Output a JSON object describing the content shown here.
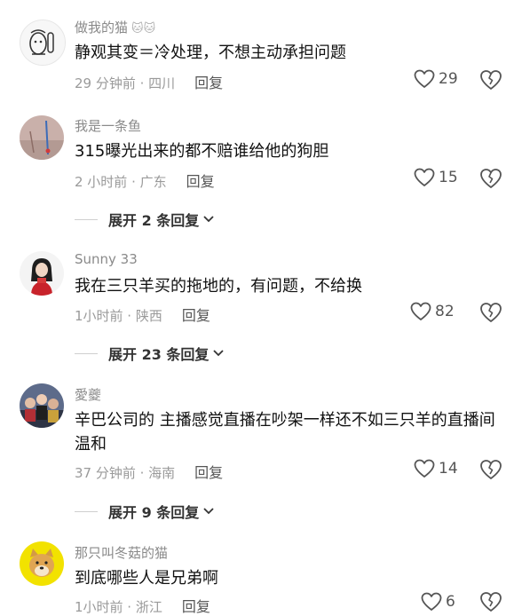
{
  "comments": [
    {
      "username": "做我的猫",
      "username_badge": "🐱🐱",
      "text": "静观其变＝冷处理，不想主动承担问题",
      "time_location": "29 分钟前 · 四川",
      "reply_label": "回复",
      "likes": "29",
      "avatar_icon": "cartoon-sketch-avatar"
    },
    {
      "username": "我是一条鱼",
      "text": "315曝光出来的都不赔谁给他的狗胆",
      "time_location": "2 小时前 · 广东",
      "reply_label": "回复",
      "likes": "15",
      "avatar_icon": "pinkish-photo-avatar"
    },
    {
      "username": "Sunny 33",
      "text": "我在三只羊买的拖地的，有问题，不给换",
      "time_location": "1小时前 · 陕西",
      "reply_label": "回复",
      "likes": "82",
      "avatar_icon": "girl-red-scarf-avatar"
    },
    {
      "username": "愛夔",
      "text": "辛巴公司的 主播感觉直播在吵架一样还不如三只羊的直播间温和",
      "time_location": "37 分钟前 · 海南",
      "reply_label": "回复",
      "likes": "14",
      "avatar_icon": "group-photo-avatar"
    },
    {
      "username": "那只叫冬菇的猫",
      "text": "到底哪些人是兄弟啊",
      "time_location": "1小时前 · 浙江",
      "reply_label": "回复",
      "likes": "6",
      "avatar_icon": "shiba-doge-avatar"
    }
  ],
  "expanders": [
    {
      "label": "展开 2 条回复"
    },
    {
      "label": "展开 23 条回复"
    },
    {
      "label": "展开 9 条回复"
    }
  ],
  "colors": {
    "text_primary": "#111111",
    "text_secondary": "#9a9a9a",
    "icon_gray": "#555555"
  }
}
